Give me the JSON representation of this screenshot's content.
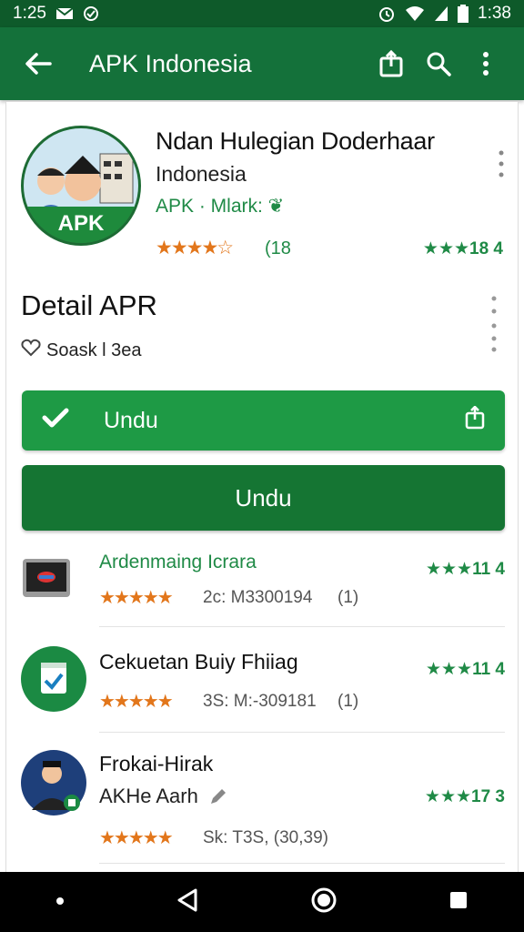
{
  "status": {
    "time": "1:25",
    "battery_time": "1:38"
  },
  "appbar": {
    "title": "APK Indonesia"
  },
  "app": {
    "title": "Ndan Hulegian Doderhaar",
    "developer": "Indonesia",
    "meta": "APK · Mlark: ❦",
    "hero_label": "APK",
    "rating_text": "(18",
    "rating_right": "★★★18 4"
  },
  "detail": {
    "title": "Detail APR",
    "size_text": "Soask l 3ea",
    "primary_button": "Undu",
    "secondary_button": "Undu"
  },
  "list": [
    {
      "title": "Ardenmaing Icrara",
      "meta": "2c: M3300194",
      "size": "(1)",
      "right": "★★★11 4"
    },
    {
      "title": "Cekuetan Buiy Fhiiag",
      "meta": "3S: M:-309181",
      "size": "(1)",
      "right": "★★★11 4"
    },
    {
      "title": "Frokai-Hirak",
      "subtitle": "AKHe Aarh",
      "meta": "Sk: T3S, (30,39)",
      "right": "★★★17 3"
    }
  ],
  "colors": {
    "appbar": "#14713a",
    "status": "#0e5a2a",
    "accent": "#1e9a45",
    "accent_dark": "#157533",
    "star": "#e2761b"
  }
}
